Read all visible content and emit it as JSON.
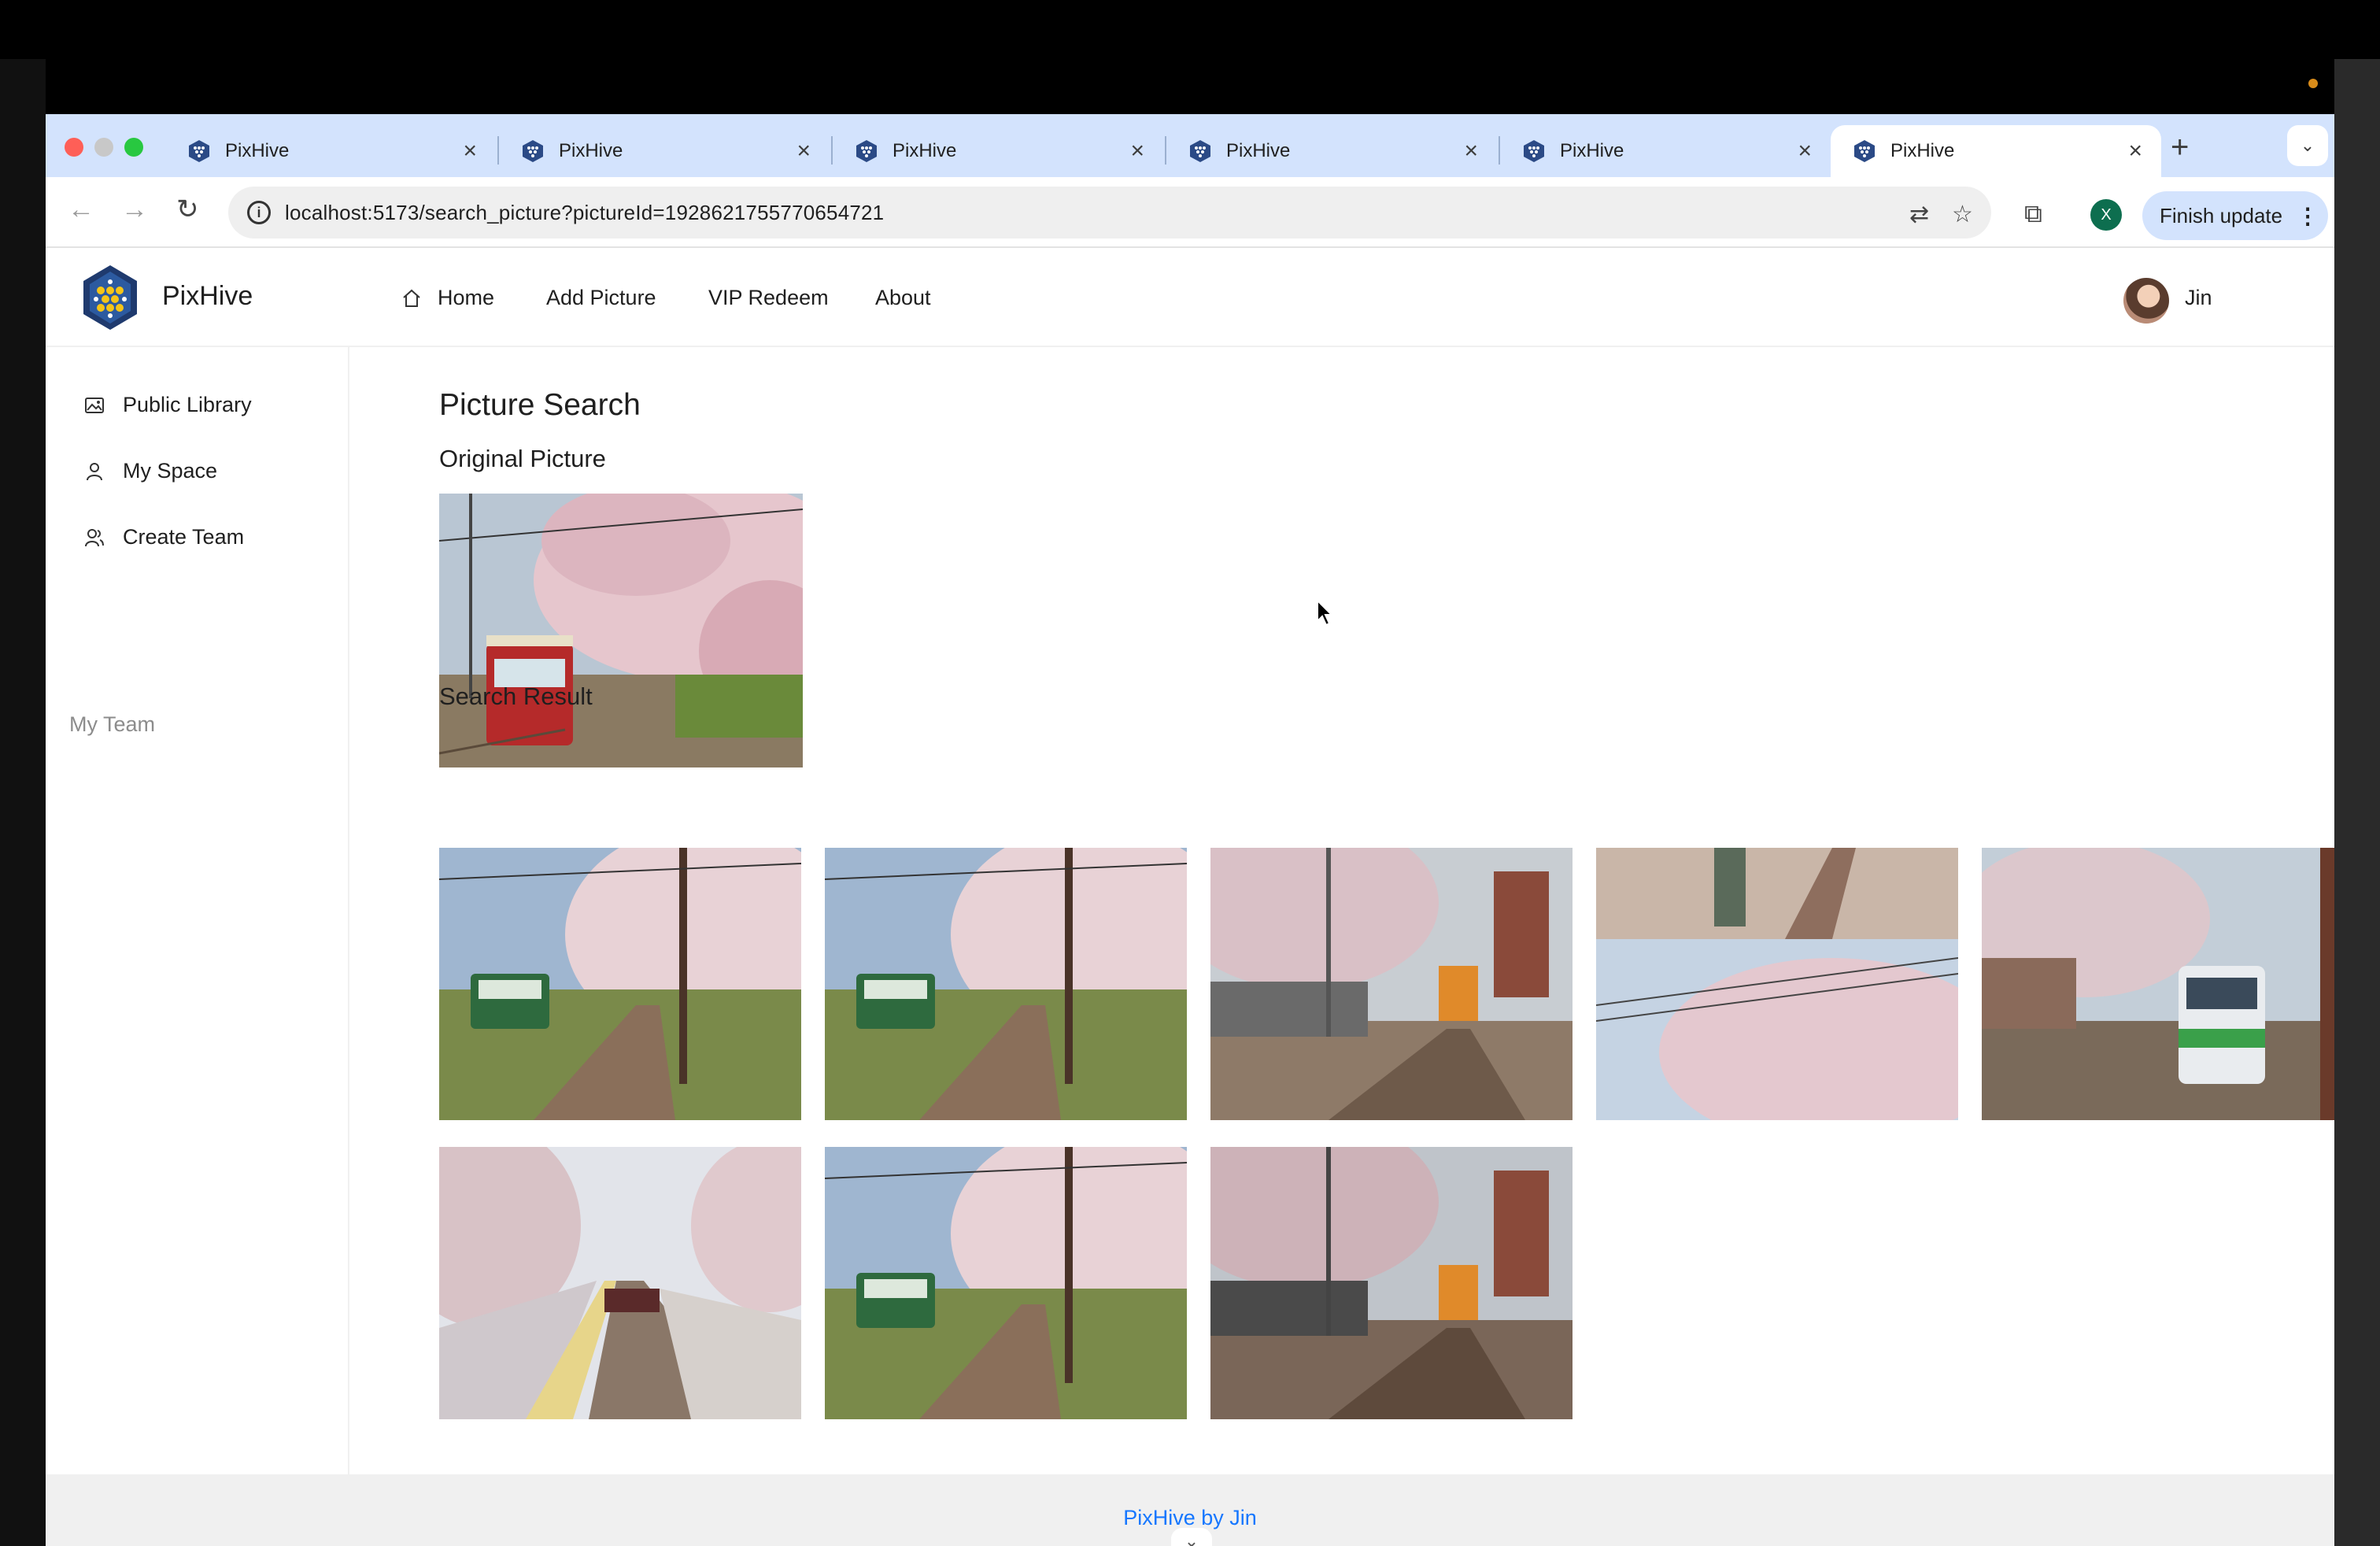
{
  "browser": {
    "tabs": [
      {
        "title": "PixHive",
        "active": false
      },
      {
        "title": "PixHive",
        "active": false
      },
      {
        "title": "PixHive",
        "active": false
      },
      {
        "title": "PixHive",
        "active": false
      },
      {
        "title": "PixHive",
        "active": false
      },
      {
        "title": "PixHive",
        "active": true
      }
    ],
    "tab_close_glyph": "×",
    "new_tab_glyph": "+",
    "url": "localhost:5173/search_picture?pictureId=1928621755770654721",
    "profile_initial": "X",
    "finish_update_label": "Finish update"
  },
  "header": {
    "brand": "PixHive",
    "nav": [
      "Home",
      "Add Picture",
      "VIP Redeem",
      "About"
    ],
    "username": "Jin"
  },
  "sidebar": {
    "items": [
      "Public Library",
      "My Space",
      "Create Team"
    ],
    "group_label": "My Team"
  },
  "main": {
    "page_title": "Picture Search",
    "original_title": "Original Picture",
    "results_title": "Search Result",
    "result_count": 8
  },
  "footer": {
    "text": "PixHive by Jin"
  },
  "colors": {
    "accent": "#1677ff",
    "tabstrip": "#d3e3fd",
    "footer_bg": "#f0f0f0"
  }
}
